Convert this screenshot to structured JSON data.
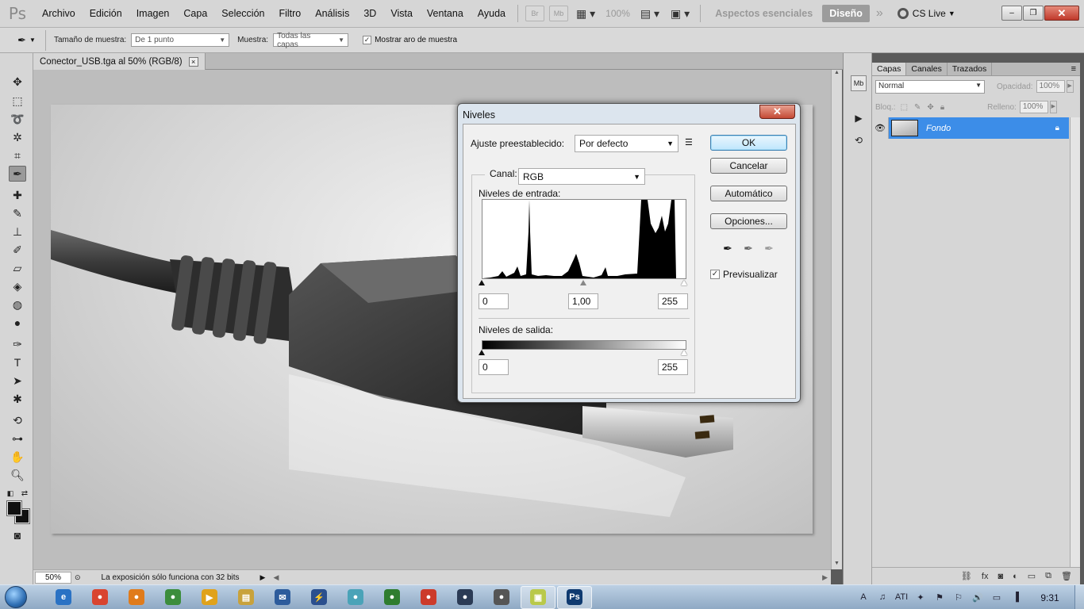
{
  "app": {
    "logo": "Ps",
    "menu": [
      "Archivo",
      "Edición",
      "Imagen",
      "Capa",
      "Selección",
      "Filtro",
      "Análisis",
      "3D",
      "Vista",
      "Ventana",
      "Ayuda"
    ],
    "bridge": "Br",
    "minibridge": "Mb",
    "zoom": "100%",
    "workspace_essentials": "Aspectos esenciales",
    "workspace_design": "Diseño",
    "more": "»",
    "cslive": "CS Live",
    "win_minimize": "–",
    "win_restore": "❐",
    "win_close": "✕"
  },
  "options_bar": {
    "sample_size_label": "Tamaño de muestra:",
    "sample_size_value": "De 1 punto",
    "sample_label": "Muestra:",
    "sample_value": "Todas las capas",
    "show_ring_label": "Mostrar aro de muestra",
    "show_ring_checked": "✓"
  },
  "document": {
    "tab_title": "Conector_USB.tga al 50% (RGB/8)",
    "tab_close": "×",
    "zoom": "50%",
    "status": "La exposición sólo funciona con 32 bits"
  },
  "layers_panel": {
    "tabs": [
      "Capas",
      "Canales",
      "Trazados"
    ],
    "blend_mode": "Normal",
    "opacity_label": "Opacidad:",
    "opacity_value": "100%",
    "lock_label": "Bloq.:",
    "fill_label": "Relleno:",
    "fill_value": "100%",
    "layer_name": "Fondo"
  },
  "levels_dialog": {
    "title": "Niveles",
    "preset_label": "Ajuste preestablecido:",
    "preset_value": "Por defecto",
    "channel_label": "Canal:",
    "channel_value": "RGB",
    "input_levels_label": "Niveles de entrada:",
    "input_black": "0",
    "input_gamma": "1,00",
    "input_white": "255",
    "output_levels_label": "Niveles de salida:",
    "output_black": "0",
    "output_white": "255",
    "ok": "OK",
    "cancel": "Cancelar",
    "auto": "Automático",
    "options": "Opciones...",
    "preview_label": "Previsualizar",
    "preview_checked": "✓"
  },
  "taskbar": {
    "apps": [
      {
        "name": "internet-explorer",
        "color": "#2a72c4",
        "glyph": "e"
      },
      {
        "name": "chrome",
        "color": "#d9442f",
        "glyph": "●"
      },
      {
        "name": "firefox",
        "color": "#e07b1b",
        "glyph": "●"
      },
      {
        "name": "messenger",
        "color": "#3c8d3c",
        "glyph": "●"
      },
      {
        "name": "media-player",
        "color": "#e0a21b",
        "glyph": "▶"
      },
      {
        "name": "explorer",
        "color": "#c8a23c",
        "glyph": "▤"
      },
      {
        "name": "mail",
        "color": "#2d5c9c",
        "glyph": "✉"
      },
      {
        "name": "thunder",
        "color": "#2a4f8e",
        "glyph": "⚡"
      },
      {
        "name": "utility",
        "color": "#4aa3b8",
        "glyph": "●"
      },
      {
        "name": "globe",
        "color": "#2f7d2f",
        "glyph": "●"
      },
      {
        "name": "media",
        "color": "#cc3b2b",
        "glyph": "●"
      },
      {
        "name": "steam",
        "color": "#2b3b55",
        "glyph": "●"
      },
      {
        "name": "audio",
        "color": "#555",
        "glyph": "●"
      },
      {
        "name": "folder",
        "color": "#b9c94a",
        "glyph": "▣"
      },
      {
        "name": "photoshop",
        "color": "#0f3a70",
        "glyph": "Ps"
      }
    ],
    "tray": [
      "A",
      "♫",
      "ATI",
      "✦",
      "⚑",
      "⚐",
      "🔊",
      "▭",
      "▐"
    ],
    "clock": "9:31"
  }
}
